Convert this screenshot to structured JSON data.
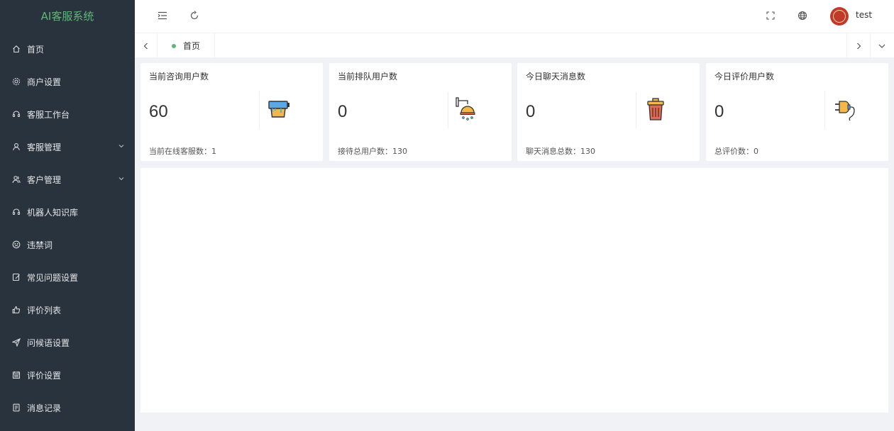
{
  "app": {
    "title": "AI客服系统"
  },
  "sidebar": {
    "items": [
      {
        "label": "首页",
        "icon": "home-icon",
        "expandable": false
      },
      {
        "label": "商户设置",
        "icon": "gear-icon",
        "expandable": false
      },
      {
        "label": "客服工作台",
        "icon": "headset-icon",
        "expandable": false
      },
      {
        "label": "客服管理",
        "icon": "user-icon",
        "expandable": true
      },
      {
        "label": "客户管理",
        "icon": "users-icon",
        "expandable": true
      },
      {
        "label": "机器人知识库",
        "icon": "robot-icon",
        "expandable": false
      },
      {
        "label": "违禁词",
        "icon": "frown-icon",
        "expandable": false
      },
      {
        "label": "常见问题设置",
        "icon": "edit-icon",
        "expandable": false
      },
      {
        "label": "评价列表",
        "icon": "thumbs-up-icon",
        "expandable": false
      },
      {
        "label": "问候语设置",
        "icon": "send-icon",
        "expandable": false
      },
      {
        "label": "评价设置",
        "icon": "calendar-icon",
        "expandable": false
      },
      {
        "label": "消息记录",
        "icon": "file-icon",
        "expandable": false
      }
    ]
  },
  "header": {
    "username": "test"
  },
  "tabs": {
    "home_label": "首页"
  },
  "cards": [
    {
      "title": "当前咨询用户数",
      "value": "60",
      "footer": "当前在线客服数：1",
      "icon": "paint-bucket-icon"
    },
    {
      "title": "当前排队用户数",
      "value": "0",
      "footer": "接待总用户数：130",
      "icon": "shower-icon"
    },
    {
      "title": "今日聊天消息数",
      "value": "0",
      "footer": "聊天消息总数：130",
      "icon": "trash-bin-icon"
    },
    {
      "title": "今日评价用户数",
      "value": "0",
      "footer": "总评价数：0",
      "icon": "plug-icon"
    }
  ],
  "colors": {
    "sidebar_bg": "#28333e",
    "accent_green": "#5fb878",
    "page_bg": "#f0f2f5"
  }
}
